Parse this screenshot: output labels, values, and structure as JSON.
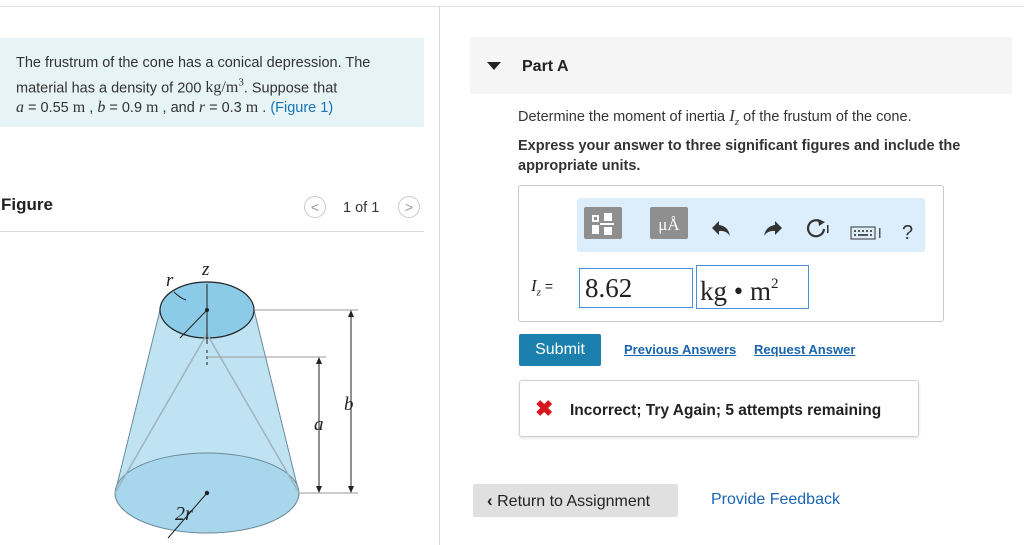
{
  "problem": {
    "line1": "The frustrum of the cone has a conical depression. The",
    "line2_pre": "material has a density of 200 ",
    "density_unit": "kg/m",
    "density_exp": "3",
    "line2_post": ". Suppose that",
    "a_var": "a",
    "a_val": " = 0.55 ",
    "b_var": "b",
    "b_val": " = 0.9 ",
    "r_var": "r",
    "r_val": " = 0.3 ",
    "unit_m": "m",
    "sep_comma": " , ",
    "sep_and": " , and ",
    "sep_dot": " . ",
    "figure_link": "(Figure 1)"
  },
  "figure": {
    "heading": "Figure",
    "counter": "1 of 1",
    "prev_icon": "chevron-left-icon",
    "next_icon": "chevron-right-icon",
    "labels": {
      "r": "r",
      "z": "z",
      "a": "a",
      "b": "b",
      "two_r": "2r"
    }
  },
  "part": {
    "collapse_icon": "triangle-down-icon",
    "title": "Part A",
    "question_pre": "Determine the moment of inertia ",
    "question_var": "I",
    "question_sub": "z",
    "question_post": " of the frustum of the cone.",
    "instruction": "Express your answer to three significant figures and include the appropriate units."
  },
  "toolbar": {
    "template_icon": "fraction-template-icon",
    "units_label": "μÅ",
    "undo_icon": "undo-icon",
    "redo_icon": "redo-icon",
    "reset_icon": "reset-icon",
    "keyboard_icon": "keyboard-icon",
    "help_label": "?"
  },
  "answer": {
    "var": "I",
    "sub": "z",
    "eq": " =",
    "value": "8.62",
    "unit": "kg • m",
    "unit_exp": "2"
  },
  "actions": {
    "submit": "Submit",
    "previous_answers": "Previous Answers",
    "request_answer": "Request Answer"
  },
  "feedback": {
    "icon": "x-mark-icon",
    "mark": "✖",
    "text": "Incorrect; Try Again; 5 attempts remaining",
    "status_color": "#d8171d"
  },
  "footer": {
    "return_icon": "chevron-left-icon",
    "return_label": "Return to Assignment",
    "provide_feedback": "Provide Feedback"
  },
  "colors": {
    "accent": "#1b80ad",
    "link": "#1a64b0",
    "problem_bg": "#e6f4f6",
    "figure_fill": "#bfe3f2"
  }
}
